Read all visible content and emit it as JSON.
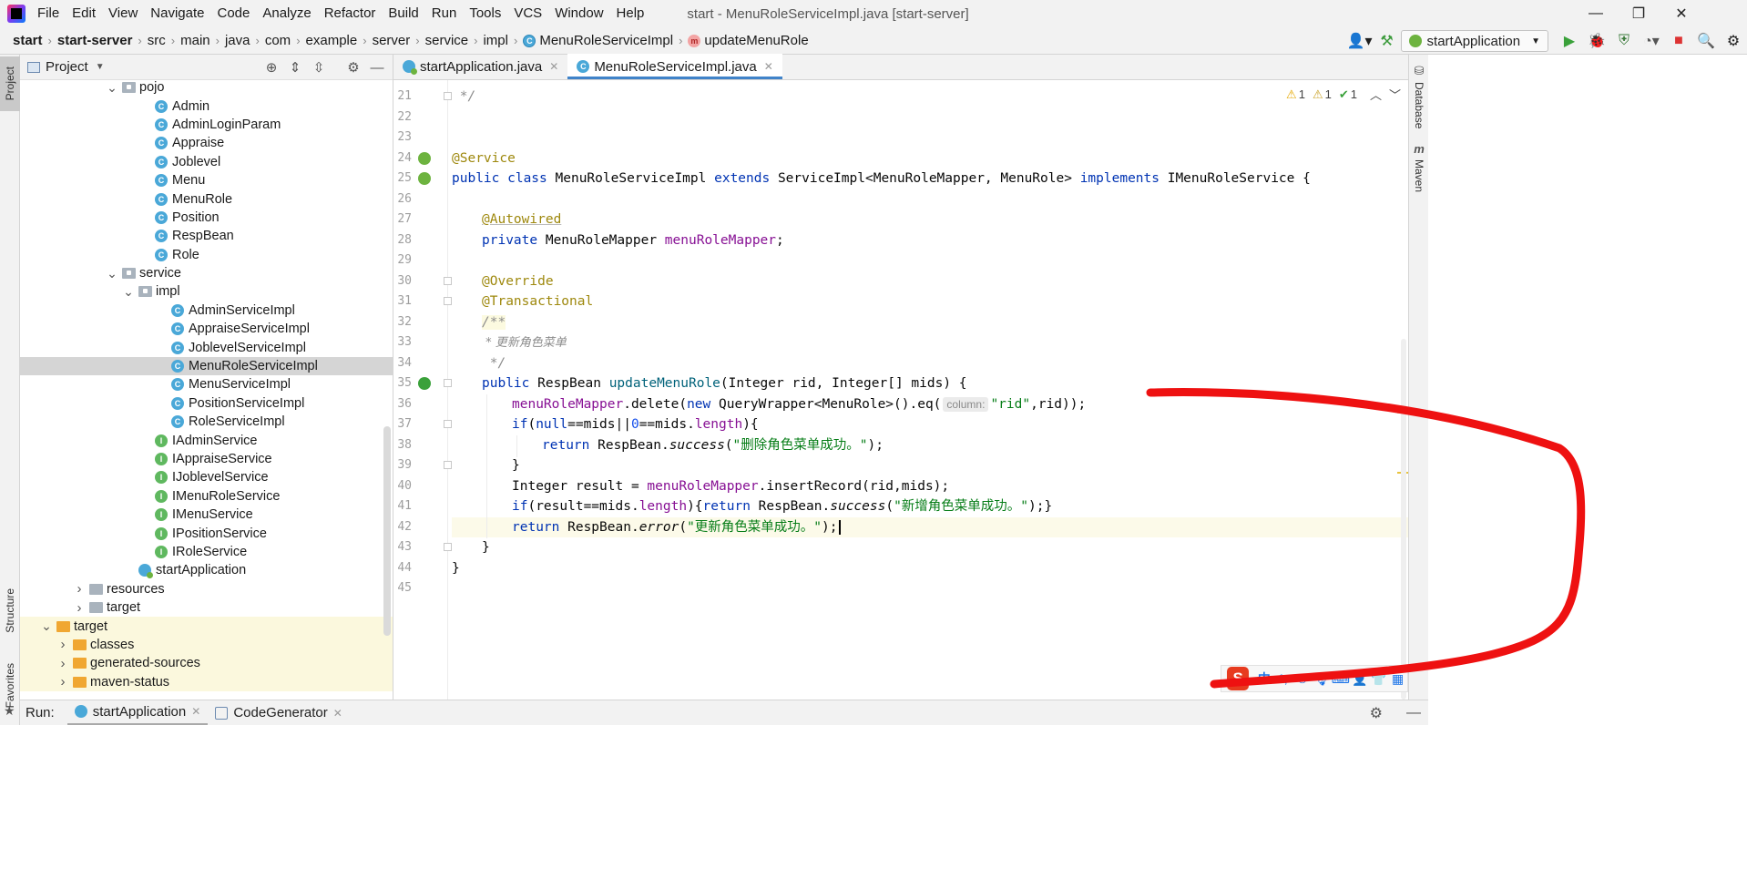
{
  "menubar": {
    "items": [
      {
        "label": "File",
        "mnemonic": "F"
      },
      {
        "label": "Edit",
        "mnemonic": "E"
      },
      {
        "label": "View",
        "mnemonic": "V"
      },
      {
        "label": "Navigate",
        "mnemonic": "N"
      },
      {
        "label": "Code",
        "mnemonic": "C"
      },
      {
        "label": "Analyze",
        "mnemonic": "z"
      },
      {
        "label": "Refactor",
        "mnemonic": "R"
      },
      {
        "label": "Build",
        "mnemonic": "B"
      },
      {
        "label": "Run",
        "mnemonic": "u"
      },
      {
        "label": "Tools",
        "mnemonic": "T"
      },
      {
        "label": "VCS",
        "mnemonic": "S"
      },
      {
        "label": "Window",
        "mnemonic": "W"
      },
      {
        "label": "Help",
        "mnemonic": "H"
      }
    ],
    "window_title": "start - MenuRoleServiceImpl.java [start-server]",
    "controls": {
      "minimize": "—",
      "restore": "❐",
      "close": "✕"
    }
  },
  "breadcrumb": {
    "items": [
      "start",
      "start-server",
      "src",
      "main",
      "java",
      "com",
      "example",
      "server",
      "service",
      "impl"
    ],
    "class_item": "MenuRoleServiceImpl",
    "method_item": "updateMenuRole",
    "class_badge": "C",
    "method_badge": "m"
  },
  "toolbar": {
    "run_config": "startApplication"
  },
  "left_strip": {
    "project": "Project",
    "structure": "Structure",
    "favorites": "Favorites"
  },
  "right_strip": {
    "database": "Database",
    "maven": "Maven",
    "maven_icon": "m"
  },
  "project_panel": {
    "title": "Project",
    "tree": [
      {
        "label": "pojo",
        "depth": 6,
        "kind": "package",
        "expanded": true
      },
      {
        "label": "Admin",
        "depth": 8,
        "kind": "class"
      },
      {
        "label": "AdminLoginParam",
        "depth": 8,
        "kind": "class"
      },
      {
        "label": "Appraise",
        "depth": 8,
        "kind": "class"
      },
      {
        "label": "Joblevel",
        "depth": 8,
        "kind": "class"
      },
      {
        "label": "Menu",
        "depth": 8,
        "kind": "class"
      },
      {
        "label": "MenuRole",
        "depth": 8,
        "kind": "class"
      },
      {
        "label": "Position",
        "depth": 8,
        "kind": "class"
      },
      {
        "label": "RespBean",
        "depth": 8,
        "kind": "class"
      },
      {
        "label": "Role",
        "depth": 8,
        "kind": "class"
      },
      {
        "label": "service",
        "depth": 6,
        "kind": "package",
        "expanded": true
      },
      {
        "label": "impl",
        "depth": 7,
        "kind": "package",
        "expanded": true
      },
      {
        "label": "AdminServiceImpl",
        "depth": 9,
        "kind": "class"
      },
      {
        "label": "AppraiseServiceImpl",
        "depth": 9,
        "kind": "class"
      },
      {
        "label": "JoblevelServiceImpl",
        "depth": 9,
        "kind": "class"
      },
      {
        "label": "MenuRoleServiceImpl",
        "depth": 9,
        "kind": "class",
        "selected": true
      },
      {
        "label": "MenuServiceImpl",
        "depth": 9,
        "kind": "class"
      },
      {
        "label": "PositionServiceImpl",
        "depth": 9,
        "kind": "class"
      },
      {
        "label": "RoleServiceImpl",
        "depth": 9,
        "kind": "class"
      },
      {
        "label": "IAdminService",
        "depth": 8,
        "kind": "interface"
      },
      {
        "label": "IAppraiseService",
        "depth": 8,
        "kind": "interface"
      },
      {
        "label": "IJoblevelService",
        "depth": 8,
        "kind": "interface"
      },
      {
        "label": "IMenuRoleService",
        "depth": 8,
        "kind": "interface"
      },
      {
        "label": "IMenuService",
        "depth": 8,
        "kind": "interface"
      },
      {
        "label": "IPositionService",
        "depth": 8,
        "kind": "interface"
      },
      {
        "label": "IRoleService",
        "depth": 8,
        "kind": "interface"
      },
      {
        "label": "startApplication",
        "depth": 7,
        "kind": "springboot"
      },
      {
        "label": "resources",
        "depth": 4,
        "kind": "folder",
        "expanded": false
      },
      {
        "label": "target",
        "depth": 4,
        "kind": "folder",
        "expanded": false
      },
      {
        "label": "target",
        "depth": 2,
        "kind": "folder-orange",
        "expanded": true,
        "highlight": true
      },
      {
        "label": "classes",
        "depth": 3,
        "kind": "folder-orange",
        "expanded": false,
        "highlight": true
      },
      {
        "label": "generated-sources",
        "depth": 3,
        "kind": "folder-orange",
        "expanded": false,
        "highlight": true
      },
      {
        "label": "maven-status",
        "depth": 3,
        "kind": "folder-orange",
        "expanded": false,
        "highlight": true
      }
    ]
  },
  "editor": {
    "tabs": [
      {
        "label": "startApplication.java",
        "active": false
      },
      {
        "label": "MenuRoleServiceImpl.java",
        "active": true
      }
    ],
    "inspections": {
      "warnings": "1",
      "weak_warnings": "1",
      "ok": "1"
    },
    "current_line": 42,
    "line_numbers": [
      "21",
      "22",
      "23",
      "24",
      "25",
      "26",
      "27",
      "28",
      "29",
      "30",
      "31",
      "32",
      "33",
      "34",
      "35",
      "36",
      "37",
      "38",
      "39",
      "40",
      "41",
      "42",
      "43",
      "44",
      "45"
    ],
    "code": {
      "l21": " */",
      "l24_ann": "@Service",
      "l25_kw1": "public class ",
      "l25_name": "MenuRoleServiceImpl ",
      "l25_kw2": "extends ",
      "l25_type": "ServiceImpl<MenuRoleMapper, MenuRole> ",
      "l25_kw3": "implements ",
      "l25_rest": "IMenuRoleService {",
      "l27_ann": "@Autowired",
      "l28_kw": "private ",
      "l28_type": "MenuRoleMapper ",
      "l28_fld": "menuRoleMapper",
      "l28_end": ";",
      "l30_ann": "@Override",
      "l31_ann": "@Transactional",
      "l32_cm": "/**",
      "l33_cm": " * 更新角色菜单",
      "l34_cm": " */",
      "l35_kw": "public ",
      "l35_rest1": "RespBean ",
      "l35_name": "updateMenuRole",
      "l35_rest2": "(Integer rid, Integer[] mids) {",
      "l36_fld": "menuRoleMapper",
      "l36_a": ".delete(",
      "l36_kw": "new ",
      "l36_b": "QueryWrapper<MenuRole>().eq(",
      "l36_hint": "column:",
      "l36_str": "\"rid\"",
      "l36_c": ",rid));",
      "l37_kw": "if",
      "l37_a": "(",
      "l37_null": "null",
      "l37_b": "==mids||",
      "l37_num": "0",
      "l37_c": "==mids.",
      "l37_len": "length",
      "l37_d": "){",
      "l38_kw": "return ",
      "l38_a": "RespBean.",
      "l38_m": "success",
      "l38_b": "(",
      "l38_str": "\"删除角色菜单成功。\"",
      "l38_c": ");",
      "l39": "}",
      "l40_a": "Integer result = ",
      "l40_fld": "menuRoleMapper",
      "l40_b": ".insertRecord(rid,mids);",
      "l41_kw": "if",
      "l41_a": "(result==mids.",
      "l41_len": "length",
      "l41_b": "){",
      "l41_kw2": "return ",
      "l41_c": "RespBean.",
      "l41_m": "success",
      "l41_d": "(",
      "l41_str": "\"新增角色菜单成功。\"",
      "l41_e": ");}",
      "l42_kw": "return ",
      "l42_a": "RespBean.",
      "l42_m": "error",
      "l42_b": "(",
      "l42_str": "\"更新角色菜单成功。\"",
      "l42_c": ");",
      "l43": "}",
      "l44": "}"
    }
  },
  "ime": {
    "logo": "S",
    "zh": "中",
    "punct": "°,",
    "items": [
      "☺",
      "🎤",
      "⌨",
      "👤",
      "👕",
      "▦"
    ]
  },
  "run_bar": {
    "label": "Run:",
    "tabs": [
      "startApplication",
      "CodeGenerator"
    ]
  },
  "colors": {
    "keyword": "#0033b3",
    "annotation": "#9e880d",
    "field": "#871094",
    "string": "#067d17",
    "comment": "#8c8c8c",
    "highlight_stroke": "#ee1111"
  }
}
